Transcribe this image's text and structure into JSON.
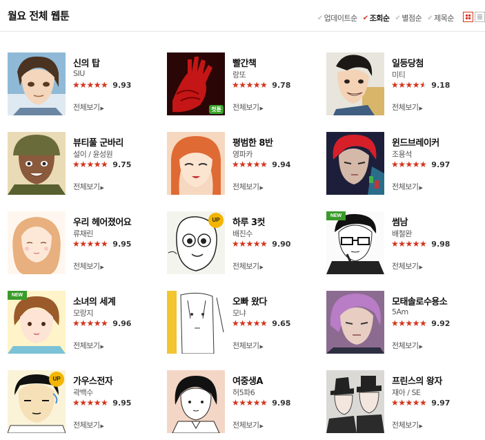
{
  "page": {
    "title": "월요 전체 웹툰"
  },
  "sort_options": [
    {
      "label": "업데이트순",
      "active": false
    },
    {
      "label": "조회순",
      "active": true
    },
    {
      "label": "별점순",
      "active": false
    },
    {
      "label": "제목순",
      "active": false
    }
  ],
  "view_toggle": {
    "grid": "grid-view-icon",
    "list": "list-view-icon"
  },
  "more_label": "전체보기",
  "webtoons": [
    {
      "title": "신의 탑",
      "author": "SIU",
      "rating": 9.93,
      "score": "9.93",
      "badge": "",
      "thumb": "tower"
    },
    {
      "title": "빨간책",
      "author": "랑또",
      "rating": 9.78,
      "score": "9.78",
      "badge": "cut",
      "badge_label": "컷툰",
      "thumb": "redhand"
    },
    {
      "title": "일등당첨",
      "author": "미티",
      "rating": 9.18,
      "score": "9.18",
      "badge": "",
      "thumb": "boy"
    },
    {
      "title": "뷰티풀 군바리",
      "author": "설이 / 윤성원",
      "rating": 9.75,
      "score": "9.75",
      "badge": "",
      "thumb": "soldier"
    },
    {
      "title": "평범한 8반",
      "author": "영파카",
      "rating": 9.94,
      "score": "9.94",
      "badge": "",
      "thumb": "girlorange"
    },
    {
      "title": "윈드브레이커",
      "author": "조용석",
      "rating": 9.97,
      "score": "9.97",
      "badge": "",
      "thumb": "redhair"
    },
    {
      "title": "우리 헤어졌어요",
      "author": "류채린",
      "rating": 9.95,
      "score": "9.95",
      "badge": "",
      "thumb": "curlygirl"
    },
    {
      "title": "하루 3컷",
      "author": "배진수",
      "rating": 9.9,
      "score": "9.90",
      "badge": "up",
      "badge_label": "UP",
      "thumb": "doodle"
    },
    {
      "title": "썸남",
      "author": "배철완",
      "rating": 9.98,
      "score": "9.98",
      "badge": "new",
      "badge_label": "NEW",
      "thumb": "glasses"
    },
    {
      "title": "소녀의 세계",
      "author": "모랑지",
      "rating": 9.96,
      "score": "9.96",
      "badge": "new",
      "badge_label": "NEW",
      "thumb": "girlworld"
    },
    {
      "title": "오빠 왔다",
      "author": "모냐",
      "rating": 9.65,
      "score": "9.65",
      "badge": "",
      "thumb": "sketch"
    },
    {
      "title": "모태솔로수용소",
      "author": "5Am",
      "rating": 9.92,
      "score": "9.92",
      "badge": "",
      "thumb": "purplehair"
    },
    {
      "title": "가우스전자",
      "author": "곽백수",
      "rating": 9.95,
      "score": "9.95",
      "badge": "up",
      "badge_label": "UP",
      "thumb": "gauss"
    },
    {
      "title": "여중생A",
      "author": "허5파6",
      "rating": 9.98,
      "score": "9.98",
      "badge": "",
      "thumb": "schoolgirl"
    },
    {
      "title": "프린스의 왕자",
      "author": "재아 / SE",
      "rating": 9.97,
      "score": "9.97",
      "badge": "",
      "thumb": "prince"
    }
  ]
}
